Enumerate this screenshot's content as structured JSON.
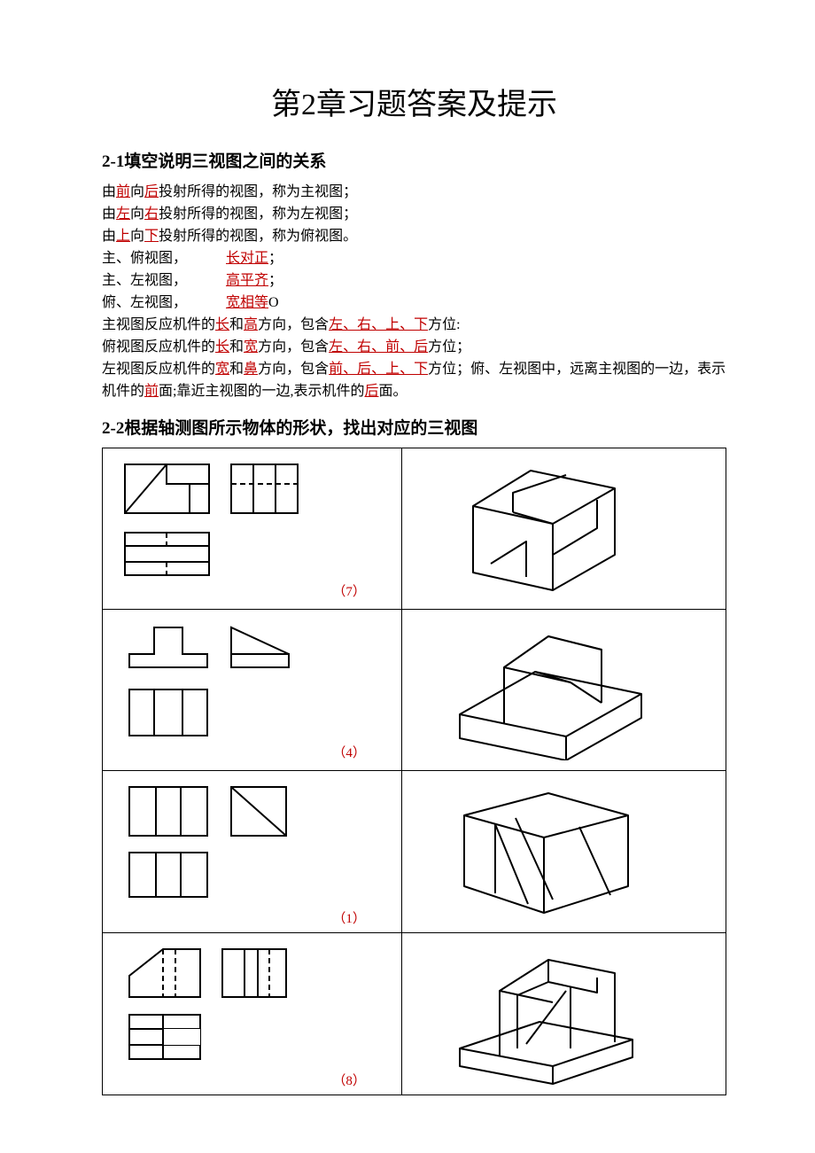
{
  "title": "第2章习题答案及提示",
  "q1": {
    "heading_num": "2-1",
    "heading_text": "填空说明三视图之间的关系",
    "l1_a": "由",
    "l1_b": "前",
    "l1_c": "向",
    "l1_d": "后",
    "l1_e": "投射所得的视图，称为主视图；",
    "l2_a": "由",
    "l2_b": "左",
    "l2_c": "向",
    "l2_d": "右",
    "l2_e": "投射所得的视图，称为左视图；",
    "l3_a": "由",
    "l3_b": "上",
    "l3_c": "向",
    "l3_d": "下",
    "l3_e": "投射所得的视图，称为俯视图。",
    "l4_a": "主、俯视图，",
    "l4_b": "长对正",
    "l4_c": "；",
    "l5_a": "主、左视图，",
    "l5_b": "高平齐",
    "l5_c": "；",
    "l6_a": "俯、左视图，",
    "l6_b": "宽相等",
    "l6_c": "O",
    "l7_a": "主视图反应机件的",
    "l7_b": "长",
    "l7_c": "和",
    "l7_d": "高",
    "l7_e": "方向，包含",
    "l7_f": "左、右、上、下",
    "l7_g": "方位:",
    "l8_a": "俯视图反应机件的",
    "l8_b": "长",
    "l8_c": "和",
    "l8_d": "宽",
    "l8_e": "方向，包含",
    "l8_f": "左、右、前、后",
    "l8_g": "方位；",
    "l9_a": "左视图反应机件的",
    "l9_b": "宽",
    "l9_c": "和",
    "l9_d": "鼻",
    "l9_e": "方向，包含",
    "l9_f": "前、后、上、下",
    "l9_g": "方位；俯、左视图中，远离主视图的一边，表示机件的",
    "l9_h": "前",
    "l9_i": "面;靠近主视图的一边,表示机件的",
    "l9_j": "后",
    "l9_k": "面。"
  },
  "q2": {
    "heading_num": "2-2",
    "heading_text": "根据轴测图所示物体的形状，找出对应的三视图",
    "answers": [
      "（7）",
      "（4）",
      "（1）",
      "（8）"
    ]
  }
}
